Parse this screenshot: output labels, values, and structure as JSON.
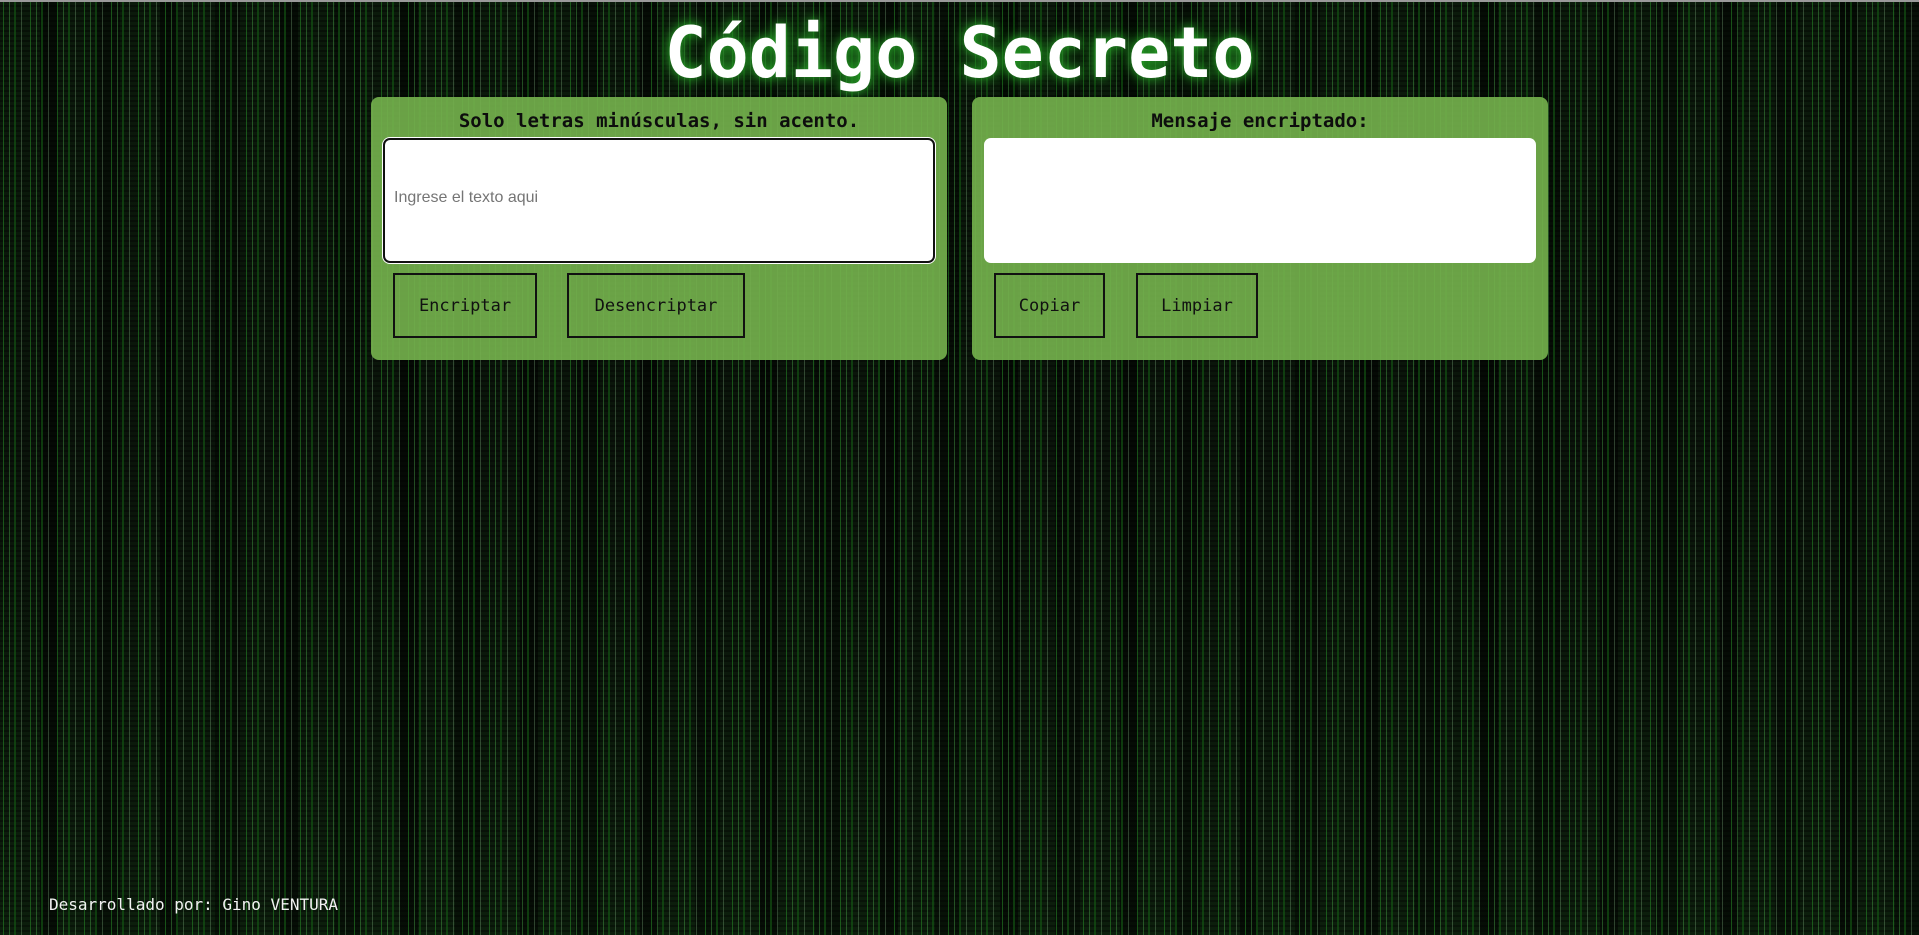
{
  "page": {
    "title": "Código Secreto",
    "accent_color": "#76b24e",
    "glow_color": "#27a227"
  },
  "encrypt_panel": {
    "heading": "Solo letras minúsculas, sin acento.",
    "input_value": "",
    "input_placeholder": "Ingrese el texto aqui",
    "encrypt_label": "Encriptar",
    "decrypt_label": "Desencriptar"
  },
  "output_panel": {
    "heading": "Mensaje encriptado:",
    "output_value": "",
    "copy_label": "Copiar",
    "clear_label": "Limpiar"
  },
  "footer": {
    "credit": "Desarrollado por: Gino VENTURA"
  }
}
